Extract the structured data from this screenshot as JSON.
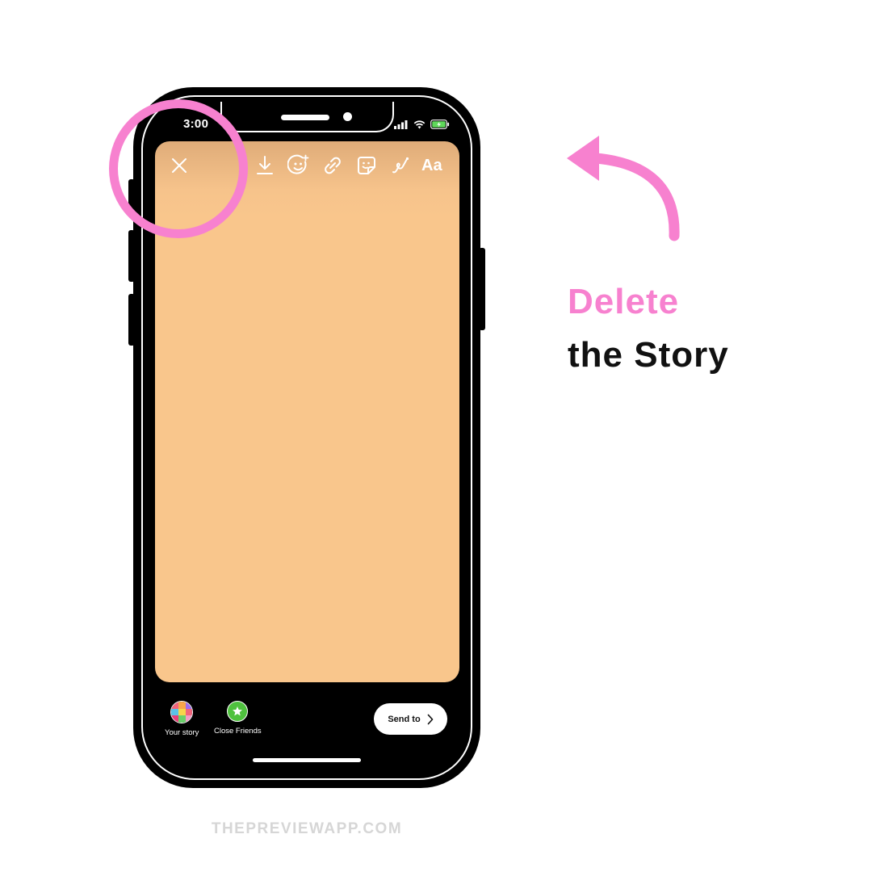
{
  "status_bar": {
    "time": "3:00"
  },
  "story_editor": {
    "toolbar": {
      "close_icon": "close-icon",
      "tools": [
        "download-icon",
        "face-effects-icon",
        "link-icon",
        "sticker-icon",
        "draw-icon"
      ],
      "text_tool_label": "Aa"
    },
    "canvas_color": "#f9c68c"
  },
  "bottom_bar": {
    "your_story_label": "Your story",
    "close_friends_label": "Close Friends",
    "send_to_label": "Send to"
  },
  "annotation": {
    "caption_line1": "Delete",
    "caption_line2": "the Story",
    "highlight_color": "#f781cf"
  },
  "footer": {
    "watermark": "THEPREVIEWAPP.COM"
  }
}
